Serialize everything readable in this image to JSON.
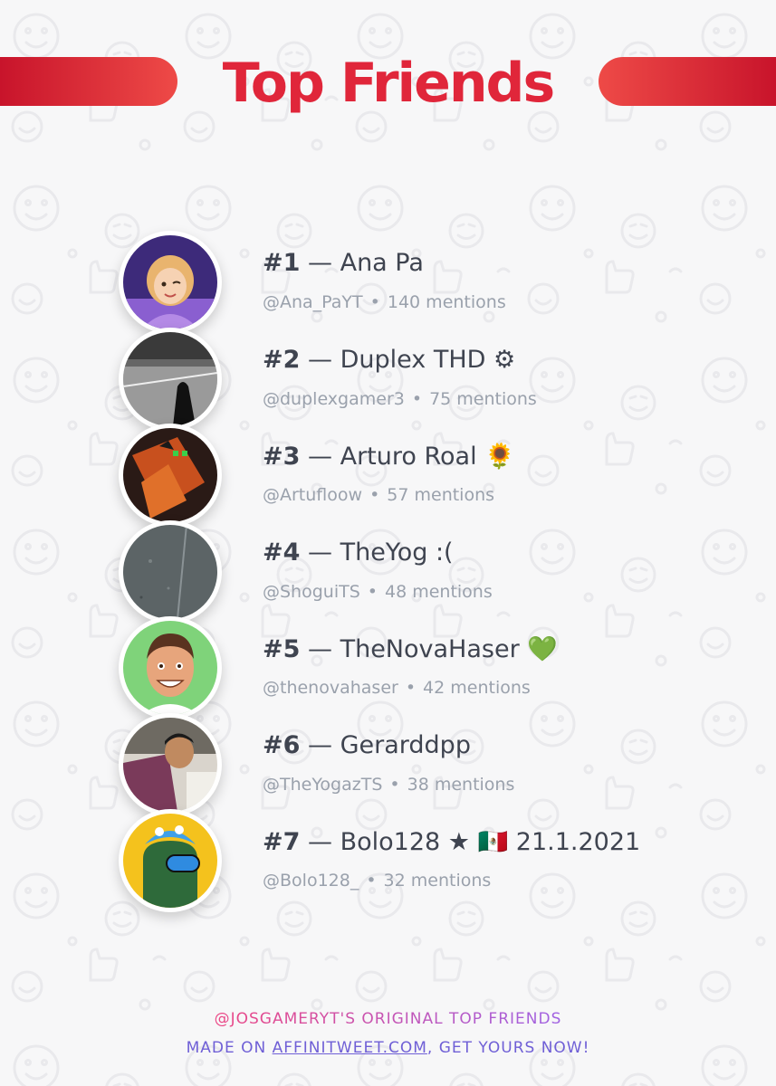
{
  "title": "Top Friends",
  "colors": {
    "accent": "#e0263a",
    "accent_dark": "#c8142b",
    "name_text": "#3f4450",
    "sub_text": "#9aa1ac",
    "footer_pink": "#f0457f",
    "footer_purple": "#6f5fd6"
  },
  "friends": [
    {
      "rank": "#1",
      "name": "Ana Pa",
      "badge": "",
      "handle": "@Ana_PaYT",
      "mentions": "140 mentions",
      "avatar_icon": "cartoon-girl-avatar"
    },
    {
      "rank": "#2",
      "name": "Duplex THD",
      "badge": "⚙",
      "handle": "@duplexgamer3",
      "mentions": "75 mentions",
      "avatar_icon": "stadium-photo-avatar"
    },
    {
      "rank": "#3",
      "name": "Arturo Roal",
      "badge": "🌻",
      "handle": "@Artufloow",
      "mentions": "57 mentions",
      "avatar_icon": "orange-creature-avatar"
    },
    {
      "rank": "#4",
      "name": "TheYog :(",
      "badge": "",
      "handle": "@ShoguiTS",
      "mentions": "48 mentions",
      "avatar_icon": "gray-texture-avatar"
    },
    {
      "rank": "#5",
      "name": "TheNovaHaser",
      "badge": "💚",
      "handle": "@thenovahaser",
      "mentions": "42 mentions",
      "avatar_icon": "smiling-man-avatar"
    },
    {
      "rank": "#6",
      "name": "Gerarddpp",
      "badge": "",
      "handle": "@TheYogazTS",
      "mentions": "38 mentions",
      "avatar_icon": "man-photo-avatar"
    },
    {
      "rank": "#7",
      "name": "Bolo128",
      "badge": "★ 🇲🇽 21.1.2021",
      "handle": "@Bolo128_",
      "mentions": "32 mentions",
      "avatar_icon": "among-us-crewmate-avatar"
    }
  ],
  "footer": {
    "line1": "@JOSGAMERYT'S ORIGINAL TOP FRIENDS",
    "line2_prefix": "MADE ON ",
    "line2_link": "AFFINITWEET.COM",
    "line2_suffix": ", GET YOURS NOW!"
  }
}
